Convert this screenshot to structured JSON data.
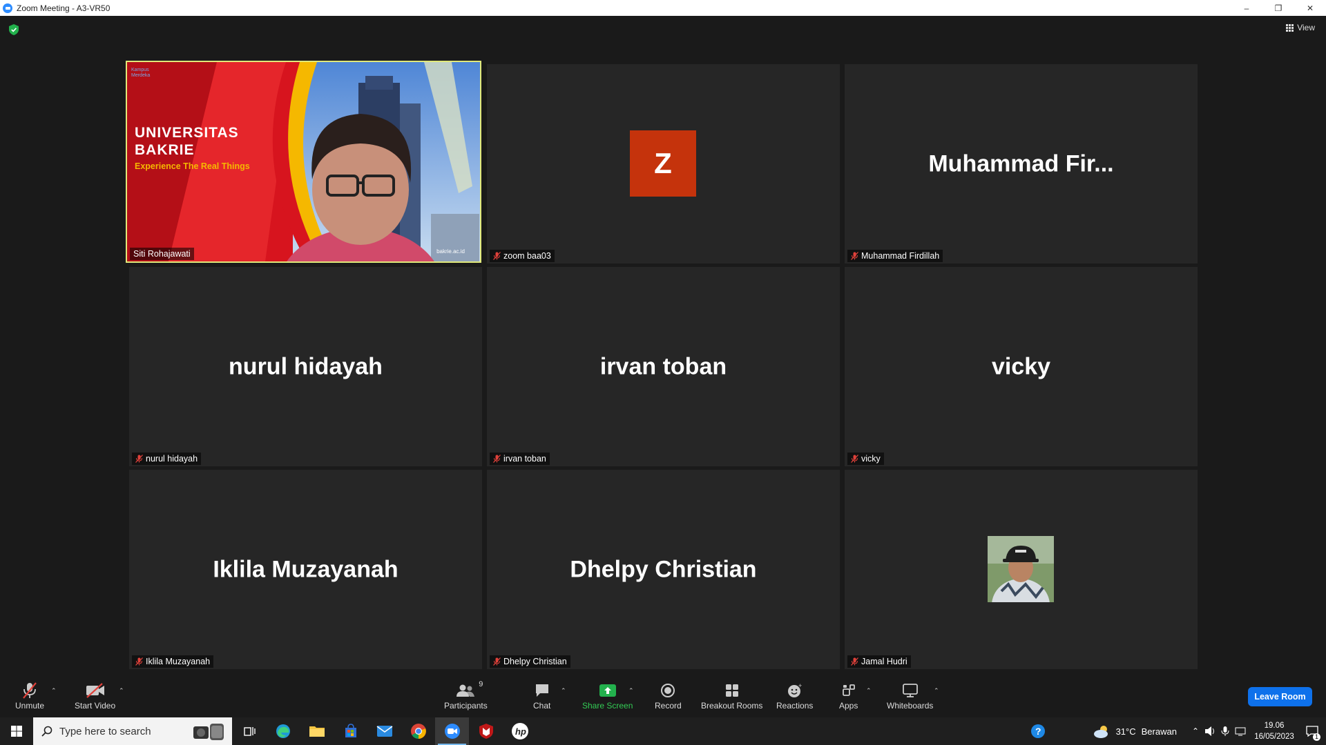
{
  "window": {
    "title": "Zoom Meeting - A3-VR50",
    "controls": [
      "–",
      "❐",
      "✕"
    ]
  },
  "meeting": {
    "view_label": "View",
    "tiles": [
      {
        "label": "Siti Rohajawati",
        "type": "video",
        "muted": false,
        "active": true,
        "video_text": {
          "line1": "UNIVERSITAS",
          "line2": "BAKRIE",
          "tagline": "Experience The Real Things",
          "corner": "Kampus Merdeka",
          "watermark": "bakrie.ac.id"
        }
      },
      {
        "label": "zoom baa03",
        "type": "letter",
        "letter": "Z",
        "muted": true
      },
      {
        "label": "Muhammad Firdillah",
        "type": "name",
        "display": "Muhammad  Fir...",
        "muted": true
      },
      {
        "label": "nurul hidayah",
        "type": "name",
        "display": "nurul hidayah",
        "muted": true
      },
      {
        "label": "irvan toban",
        "type": "name",
        "display": "irvan toban",
        "muted": true
      },
      {
        "label": "vicky",
        "type": "name",
        "display": "vicky",
        "muted": true
      },
      {
        "label": "Iklila Muzayanah",
        "type": "name",
        "display": "Iklila Muzayanah",
        "muted": true
      },
      {
        "label": "Dhelpy Christian",
        "type": "name",
        "display": "Dhelpy Christian",
        "muted": true
      },
      {
        "label": "Jamal Hudri",
        "type": "photo",
        "muted": true
      }
    ]
  },
  "toolbar": {
    "unmute": "Unmute",
    "start_video": "Start Video",
    "participants": "Participants",
    "participants_count": "9",
    "chat": "Chat",
    "share_screen": "Share Screen",
    "record": "Record",
    "breakout_rooms": "Breakout Rooms",
    "reactions": "Reactions",
    "apps": "Apps",
    "whiteboards": "Whiteboards",
    "leave": "Leave Room"
  },
  "taskbar": {
    "search_placeholder": "Type here to search",
    "weather_temp": "31°C",
    "weather_text": "Berawan",
    "time": "19.06",
    "date": "16/05/2023",
    "notification_count": "1"
  },
  "colors": {
    "background": "#1a1a1a",
    "tile": "#262626",
    "active_border": "#e1e97a",
    "avatar_letter_bg": "#c5330c",
    "leave_button": "#0e71eb",
    "share_green": "#33cc55",
    "muted_red": "#e0413a"
  }
}
